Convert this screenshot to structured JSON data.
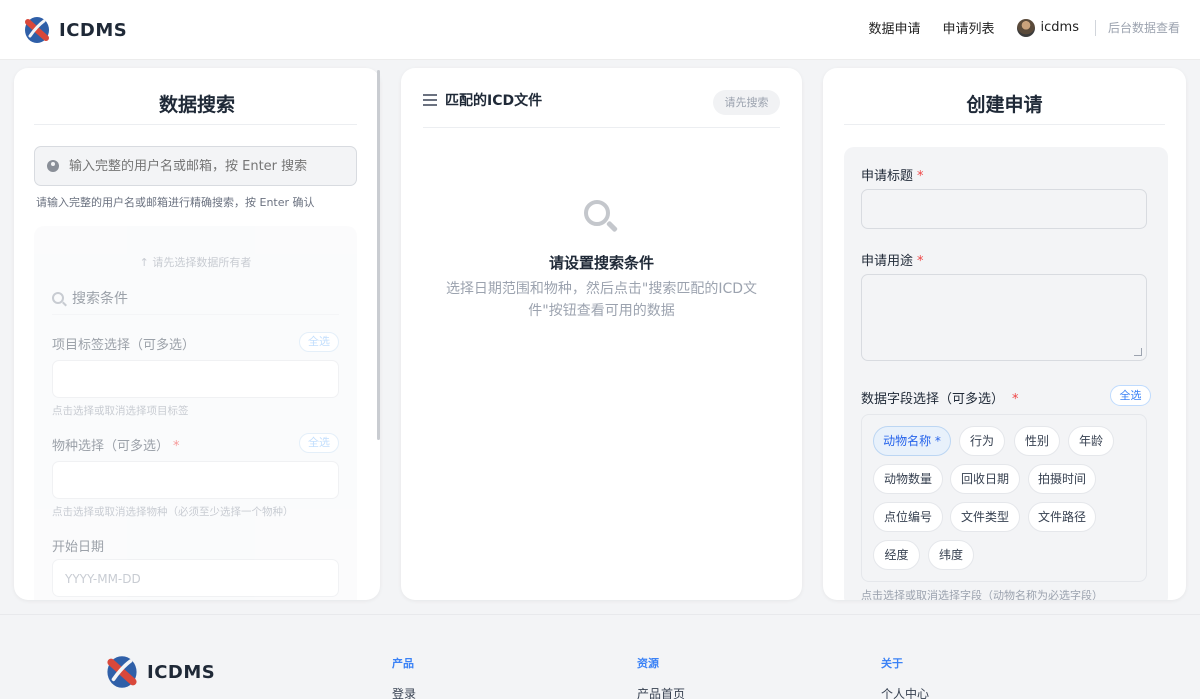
{
  "header": {
    "brand": "ICDMS",
    "nav": [
      "数据申请",
      "申请列表"
    ],
    "username": "icdms",
    "admin_link": "后台数据查看"
  },
  "search_panel": {
    "title": "数据搜索",
    "search_placeholder": "输入完整的用户名或邮箱，按 Enter 搜索",
    "search_hint": "请输入完整的用户名或邮箱进行精确搜索，按 Enter 确认",
    "owner_tip": "↑ 请先选择数据所有者",
    "conditions_title": "搜索条件",
    "tag_label": "项目标签选择（可多选）",
    "tag_select_all": "全选",
    "tag_hint": "点击选择或取消选择项目标签",
    "species_label": "物种选择（可多选）",
    "species_required": "*",
    "species_select_all": "全选",
    "species_hint": "点击选择或取消选择物种（必须至少选择一个物种）",
    "start_date_label": "开始日期",
    "start_date_placeholder": "YYYY-MM-DD"
  },
  "match_panel": {
    "title": "匹配的ICD文件",
    "badge": "请先搜索",
    "empty_title": "请设置搜索条件",
    "empty_desc": "选择日期范围和物种，然后点击\"搜索匹配的ICD文件\"按钮查看可用的数据"
  },
  "create_panel": {
    "title": "创建申请",
    "title_label": "申请标题",
    "purpose_label": "申请用途",
    "required_mark": "*",
    "fields_label": "数据字段选择（可多选）",
    "select_all": "全选",
    "fields": [
      "动物名称 *",
      "行为",
      "性别",
      "年龄",
      "动物数量",
      "回收日期",
      "拍摄时间",
      "点位编号",
      "文件类型",
      "文件路径",
      "经度",
      "纬度"
    ],
    "fields_hint": "点击选择或取消选择字段（动物名称为必选字段）"
  },
  "footer": {
    "brand": "ICDMS",
    "columns": [
      {
        "title": "产品",
        "link": "登录"
      },
      {
        "title": "资源",
        "link": "产品首页"
      },
      {
        "title": "关于",
        "link": "个人中心"
      }
    ]
  },
  "colors": {
    "accent": "#3b82f6",
    "required": "#ef4444"
  }
}
